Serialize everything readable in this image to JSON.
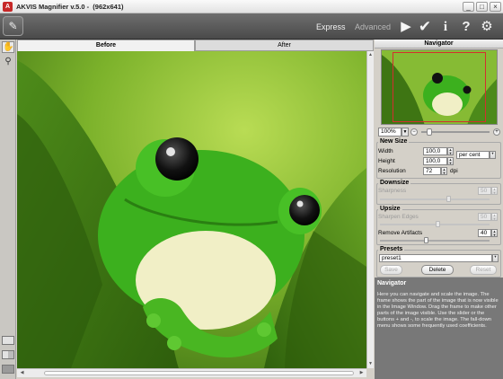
{
  "window": {
    "title": "AKVIS Magnifier v.5.0 -  (962x641)"
  },
  "toolbar": {
    "mode_express": "Express",
    "mode_advanced": "Advanced"
  },
  "tabs": {
    "before": "Before",
    "after": "After"
  },
  "navigator": {
    "header": "Navigator",
    "zoom": "100%"
  },
  "new_size": {
    "title": "New Size",
    "width_label": "Width",
    "width_value": "100,0",
    "height_label": "Height",
    "height_value": "100,0",
    "unit": "per cent",
    "resolution_label": "Resolution",
    "resolution_value": "72",
    "resolution_unit": "dpi"
  },
  "downsize": {
    "title": "Downsize",
    "sharpness_label": "Sharpness",
    "sharpness_value": "50"
  },
  "upsize": {
    "title": "Upsize",
    "sharpen_label": "Sharpen Edges",
    "sharpen_value": "50",
    "artifacts_label": "Remove Artifacts",
    "artifacts_value": "40"
  },
  "presets": {
    "title": "Presets",
    "selected": "preset1",
    "save": "Save",
    "delete": "Delete",
    "reset": "Reset"
  },
  "help": {
    "title": "Navigator",
    "text": "Here you can navigate and scale the image. The frame shows the part of the image that is now visible in the Image Window. Drag the frame to make other parts of the image visible. Use the slider or the buttons + and -, to scale the image. The fall-down menu shows some frequently used coefficients."
  },
  "colors": {
    "toolbar": "#5a5a5a",
    "help_bg": "#787878",
    "leaf_green": "#5f9a1e",
    "frog_green": "#3cb01e"
  }
}
